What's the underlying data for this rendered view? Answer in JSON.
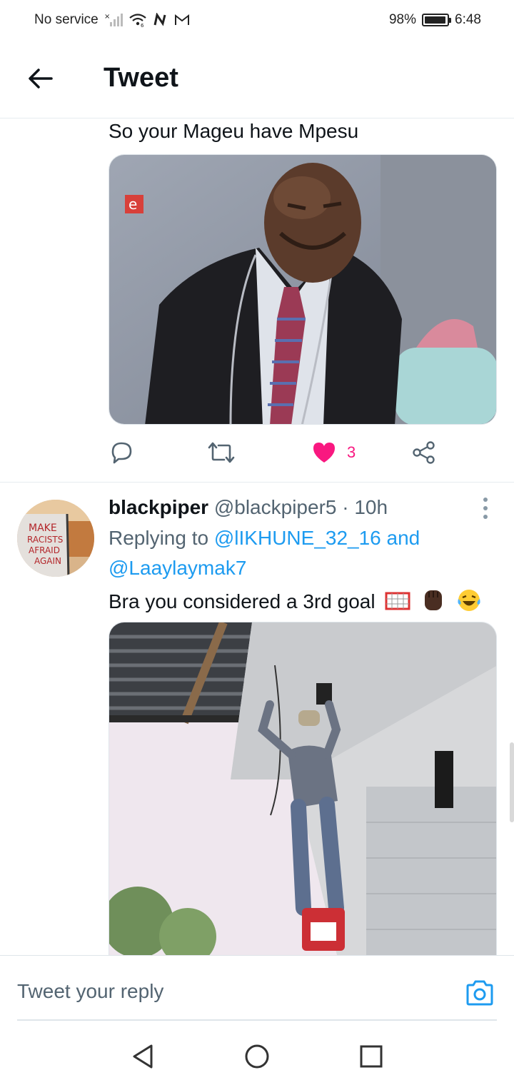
{
  "status_bar": {
    "carrier": "No service",
    "battery_percent": "98%",
    "battery_level": 0.98,
    "time": "6:48",
    "icons": [
      "signal-icon",
      "wifi-icon",
      "nfc-icon",
      "gmail-icon",
      "battery-icon"
    ]
  },
  "header": {
    "title": "Tweet",
    "back_icon": "back-arrow-icon"
  },
  "tweet1": {
    "text": "So your Mageu have Mpesu",
    "media_description": "photo-man-in-suit",
    "actions": {
      "reply_icon": "reply-icon",
      "retweet_icon": "retweet-icon",
      "like_icon": "heart-icon",
      "like_count": "3",
      "share_icon": "share-icon"
    },
    "colors": {
      "like": "#f91880"
    }
  },
  "tweet2": {
    "display_name": "blackpiper",
    "meta": "@blackpiper5 · 10h",
    "replying_to_label": "Replying to ",
    "mention1": "@lIKHUNE_32_16",
    "and": " and",
    "mention2": "@Laaylaymak7",
    "text": "Bra you considered a 3rd goal",
    "emojis": [
      "goal-net-emoji",
      "raised-fist-emoji",
      "laughing-tears-emoji"
    ],
    "media_description": "photo-man-on-ladder",
    "colors": {
      "mention": "#1d9bf0"
    }
  },
  "composer": {
    "placeholder": "Tweet your reply",
    "camera_icon": "camera-icon"
  },
  "nav_bar": {
    "icons": [
      "nav-back-icon",
      "nav-home-icon",
      "nav-recents-icon"
    ]
  }
}
